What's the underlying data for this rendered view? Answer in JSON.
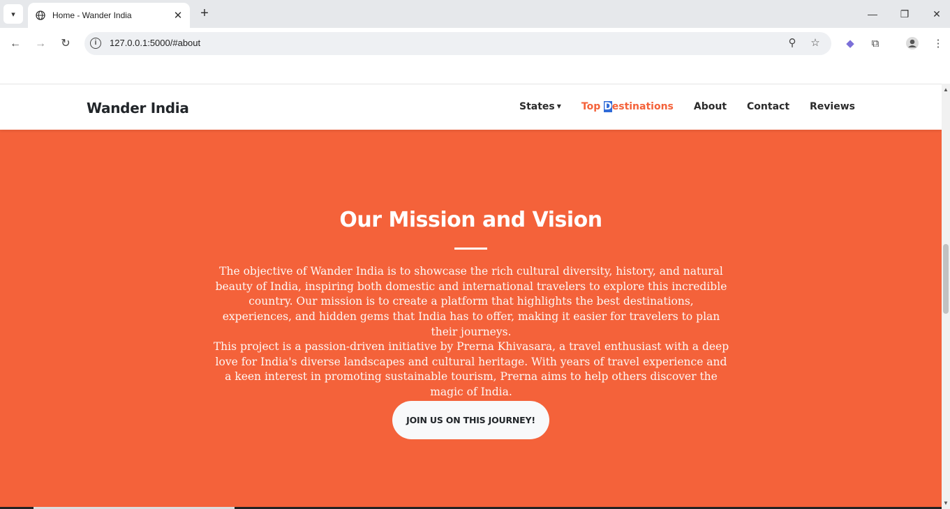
{
  "browser": {
    "tab_title": "Home - Wander India",
    "url": "127.0.0.1:5000/#about",
    "icons": [
      "tab-search-icon",
      "globe-icon",
      "close-icon",
      "new-tab-icon",
      "minimize-icon",
      "restore-icon",
      "window-close-icon",
      "back-icon",
      "forward-icon",
      "reload-icon",
      "site-info-icon",
      "zoom-icon",
      "bookmark-star-icon",
      "extension-icon",
      "puzzle-icon",
      "profile-icon",
      "menu-icon"
    ]
  },
  "navbar": {
    "brand": "Wander India",
    "links": [
      {
        "label": "States",
        "has_dropdown": true
      },
      {
        "label": "Top Destinations",
        "active": true
      },
      {
        "label": "About"
      },
      {
        "label": "Contact"
      },
      {
        "label": "Reviews"
      }
    ]
  },
  "about": {
    "heading": "Our Mission and Vision",
    "paragraph1": "The objective of Wander India is to showcase the rich cultural diversity, history, and natural beauty of India, inspiring both domestic and international travelers to explore this incredible country. Our mission is to create a platform that highlights the best destinations, experiences, and hidden gems that India has to offer, making it easier for travelers to plan their journeys.",
    "paragraph2": "This project is a passion-driven initiative by Prerna Khivasara, a travel enthusiast with a deep love for India's diverse landscapes and cultural heritage. With years of travel experience and a keen interest in promoting sustainable tourism, Prerna aims to help others discover the magic of India.",
    "cta_label": "JOIN US ON THIS JOURNEY!"
  },
  "colors": {
    "accent": "#f4623a",
    "button_bg": "#f8f9fa",
    "text_dark": "#212529"
  }
}
